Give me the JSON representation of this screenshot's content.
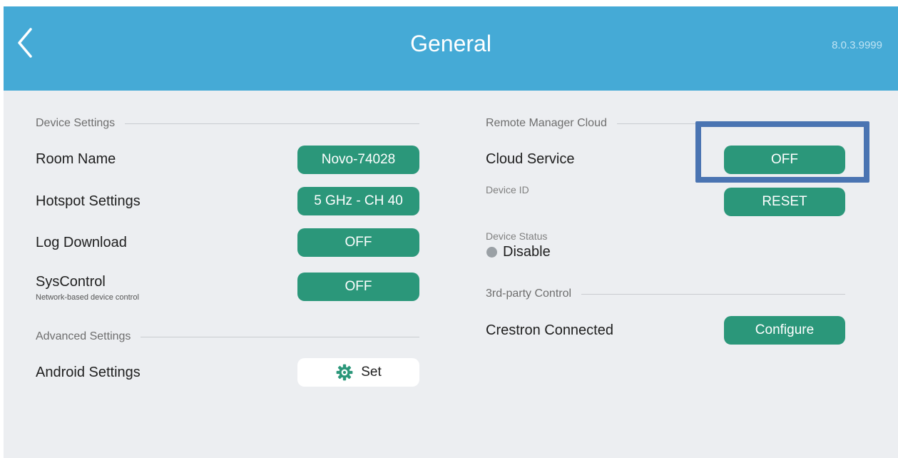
{
  "header": {
    "title": "General",
    "version": "8.0.3.9999"
  },
  "device_settings": {
    "heading": "Device Settings",
    "room_name": {
      "label": "Room Name",
      "value": "Novo-74028"
    },
    "hotspot": {
      "label": "Hotspot Settings",
      "value": "5 GHz - CH 40"
    },
    "log_download": {
      "label": "Log Download",
      "value": "OFF"
    },
    "syscontrol": {
      "label": "SysControl",
      "sublabel": "Network-based device control",
      "value": "OFF"
    }
  },
  "advanced_settings": {
    "heading": "Advanced Settings",
    "android": {
      "label": "Android Settings",
      "value": "Set"
    }
  },
  "remote_manager": {
    "heading": "Remote Manager Cloud",
    "cloud_service": {
      "label": "Cloud Service",
      "value": "OFF"
    },
    "device_id": {
      "label": "Device ID",
      "button": "RESET"
    },
    "device_status": {
      "label": "Device Status",
      "value": "Disable",
      "dot_color": "#9aa0a5"
    }
  },
  "third_party": {
    "heading": "3rd-party Control",
    "crestron": {
      "label": "Crestron Connected",
      "button": "Configure"
    }
  },
  "colors": {
    "header": "#45aad6",
    "accent": "#2b977a",
    "background": "#eceef1",
    "highlight": "#4a74b2"
  }
}
